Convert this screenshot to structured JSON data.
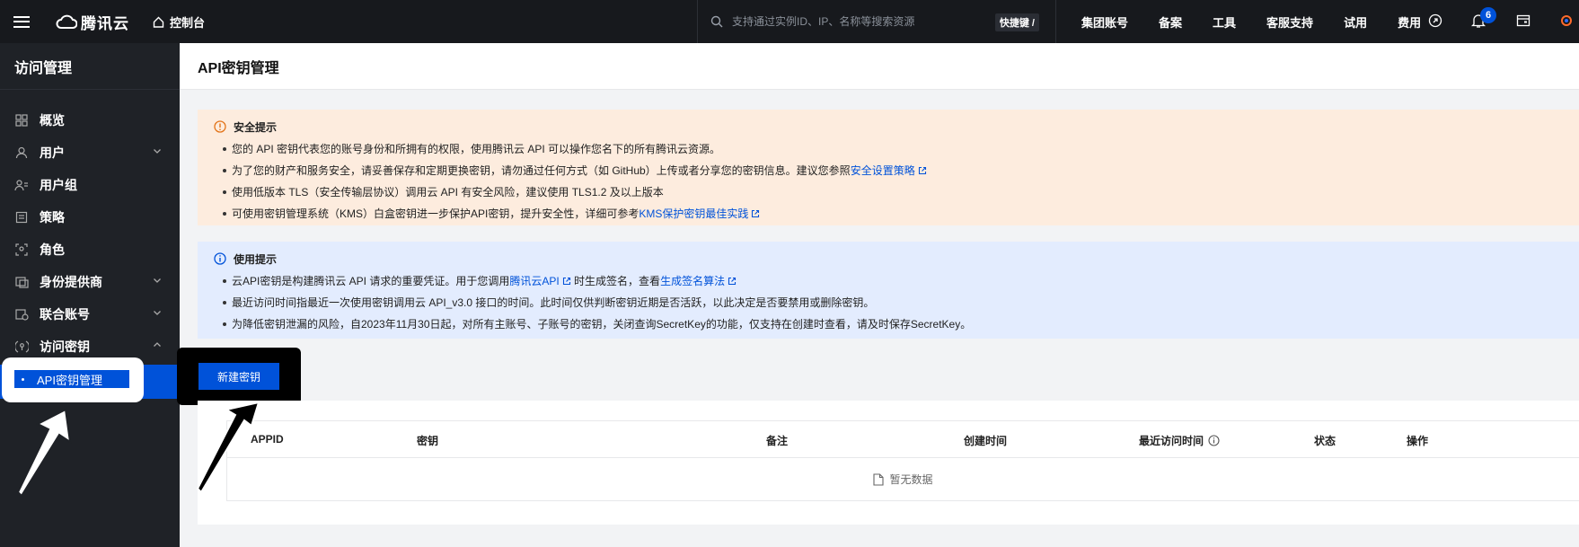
{
  "topbar": {
    "brand": "腾讯云",
    "console": "控制台",
    "search_placeholder": "支持通过实例ID、IP、名称等搜索资源",
    "shortcut": "快捷键 /",
    "nav": [
      "集团账号",
      "备案",
      "工具",
      "客服支持",
      "试用",
      "费用"
    ],
    "notification_count": "6",
    "icons": [
      "menu-icon",
      "cloud-logo-icon",
      "home-icon",
      "search-icon",
      "link-icon",
      "bell-icon",
      "wallet-icon",
      "app-icon"
    ]
  },
  "sidebar": {
    "title": "访问管理",
    "items": [
      {
        "label": "概览",
        "icon": "grid-icon"
      },
      {
        "label": "用户",
        "icon": "user-icon",
        "expandable": true
      },
      {
        "label": "用户组",
        "icon": "user-group-icon"
      },
      {
        "label": "策略",
        "icon": "policy-icon"
      },
      {
        "label": "角色",
        "icon": "role-icon"
      },
      {
        "label": "身份提供商",
        "icon": "identity-provider-icon",
        "expandable": true
      },
      {
        "label": "联合账号",
        "icon": "federated-account-icon",
        "expandable": true
      },
      {
        "label": "访问密钥",
        "icon": "key-icon",
        "expandable": true,
        "expanded": true
      }
    ],
    "sub_item_active": "API密钥管理"
  },
  "page": {
    "title": "API密钥管理",
    "security_notice": {
      "title": "安全提示",
      "lines": [
        {
          "text": "您的 API 密钥代表您的账号身份和所拥有的权限，使用腾讯云 API 可以操作您名下的所有腾讯云资源。"
        },
        {
          "text": "为了您的财产和服务安全，请妥善保存和定期更换密钥，请勿通过任何方式（如 GitHub）上传或者分享您的密钥信息。建议您参照",
          "link": "安全设置策略"
        },
        {
          "text": "使用低版本 TLS（安全传输层协议）调用云 API 有安全风险，建议使用 TLS1.2 及以上版本"
        },
        {
          "text": "可使用密钥管理系统（KMS）白盒密钥进一步保护API密钥，提升安全性，详细可参考",
          "link": "KMS保护密钥最佳实践"
        }
      ]
    },
    "usage_notice": {
      "title": "使用提示",
      "line1_a": "云API密钥是构建腾讯云 API 请求的重要凭证。用于您调用",
      "line1_link1": "腾讯云API",
      "line1_b": "时生成签名，查看",
      "line1_link2": "生成签名算法",
      "line2": "最近访问时间指最近一次使用密钥调用云 API_v3.0 接口的时间。此时间仅供判断密钥近期是否活跃，以此决定是否要禁用或删除密钥。",
      "line3": "为降低密钥泄漏的风险，自2023年11月30日起，对所有主账号、子账号的密钥，关闭查询SecretKey的功能，仅支持在创建时查看，请及时保存SecretKey。"
    },
    "new_key_button": "新建密钥",
    "table": {
      "columns": [
        "APPID",
        "密钥",
        "备注",
        "创建时间",
        "最近访问时间",
        "状态",
        "操作"
      ],
      "empty_text": "暂无数据"
    }
  },
  "colors": {
    "topbar_bg": "#17191d",
    "sidebar_bg": "#1f2227",
    "primary": "#0052d9",
    "warn_bg": "#fdecde",
    "info_bg": "#e3ecfe"
  }
}
